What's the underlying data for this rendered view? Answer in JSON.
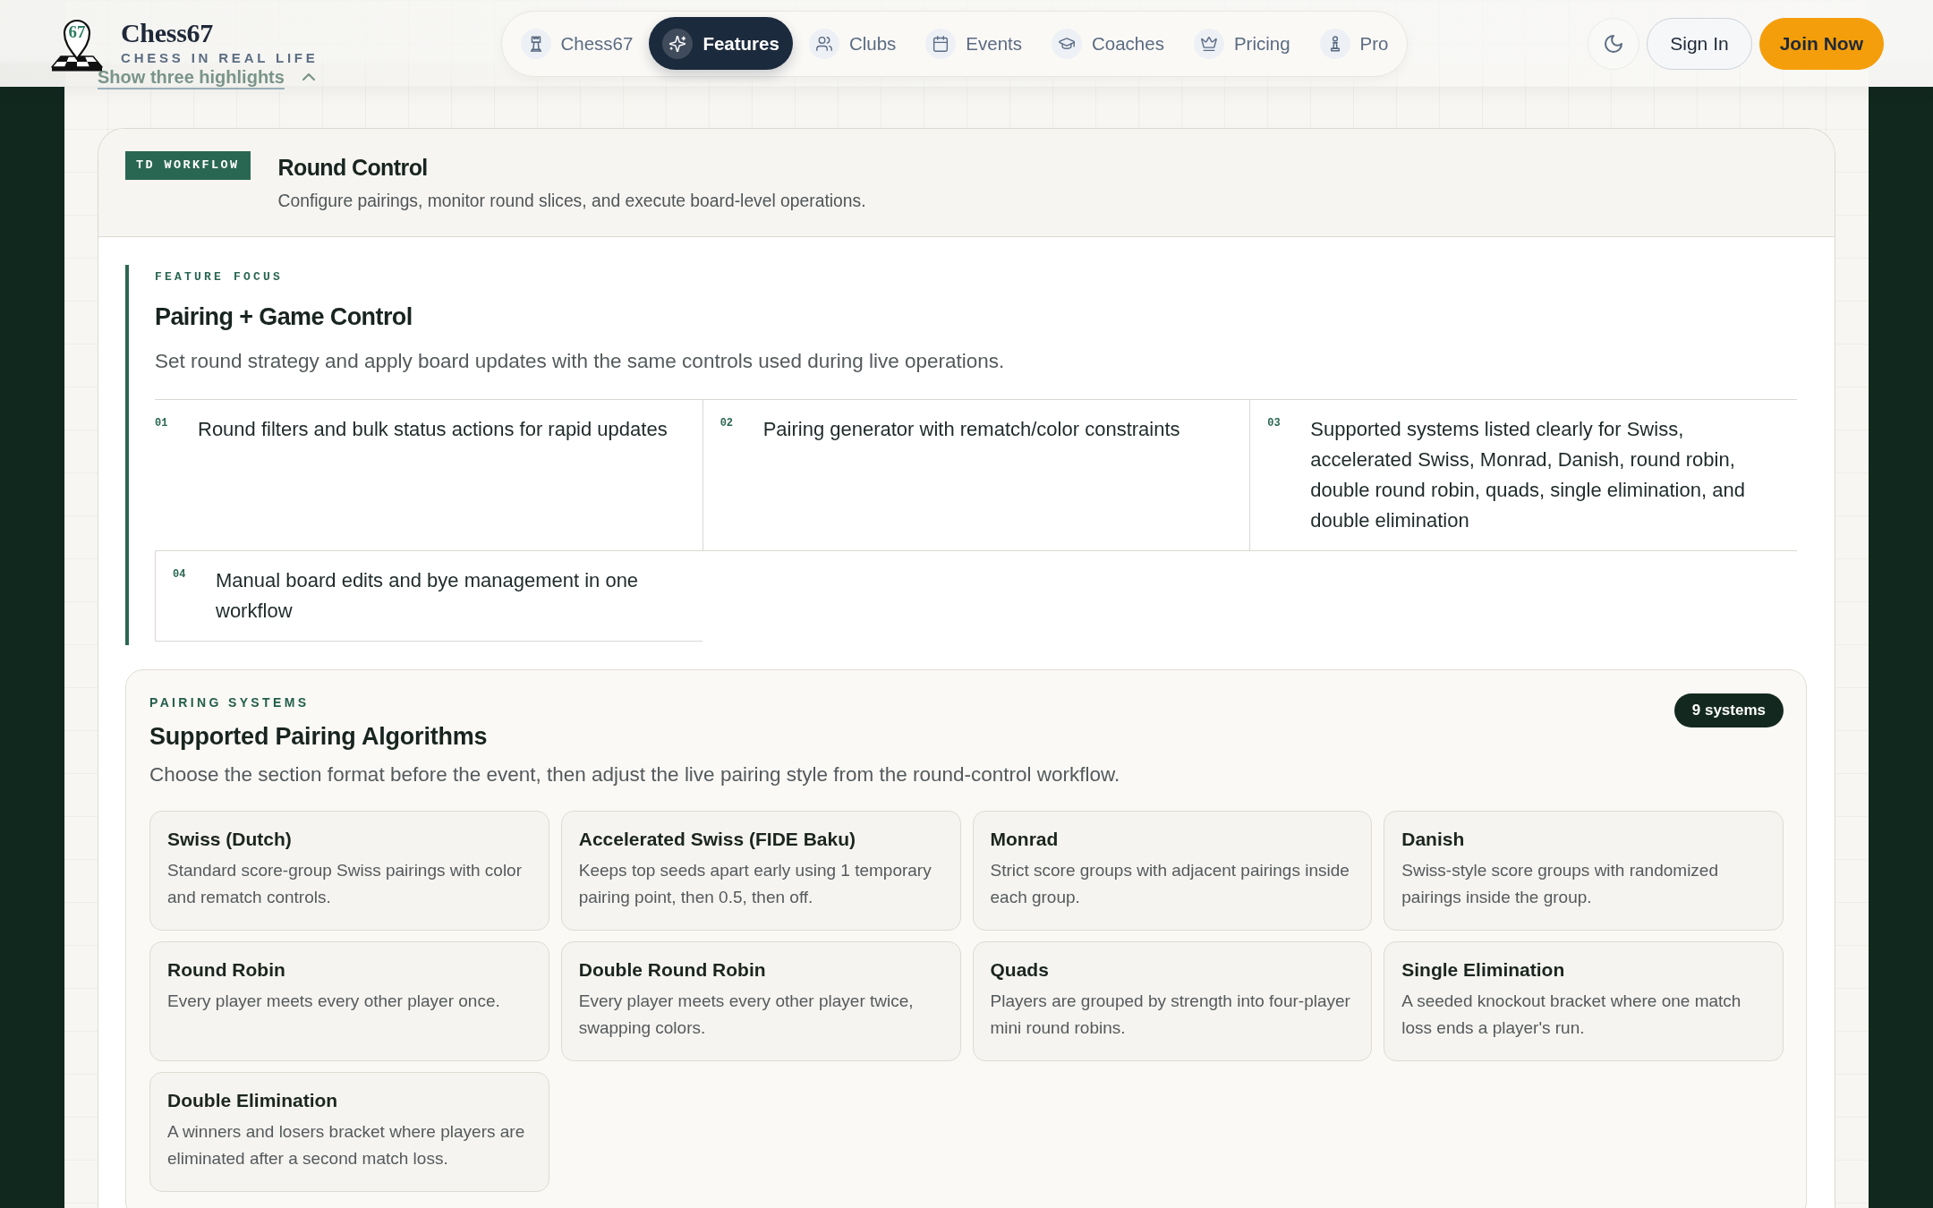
{
  "header": {
    "logo": {
      "number": "67",
      "name": "Chess67",
      "tagline": "CHESS IN REAL LIFE"
    },
    "nav": [
      {
        "label": "Chess67",
        "selected": false
      },
      {
        "label": "Features",
        "selected": true
      },
      {
        "label": "Clubs",
        "selected": false
      },
      {
        "label": "Events",
        "selected": false
      },
      {
        "label": "Coaches",
        "selected": false
      },
      {
        "label": "Pricing",
        "selected": false
      },
      {
        "label": "Pro",
        "selected": false
      }
    ],
    "actions": [
      {
        "label": "Sign In",
        "kind": "secondary"
      },
      {
        "label": "Join Now",
        "kind": "primary"
      }
    ]
  },
  "highlights_link": {
    "label": "Show three highlights"
  },
  "round_control": {
    "tag": "TD WORKFLOW",
    "title": "Round Control",
    "subtitle": "Configure pairings, monitor round slices, and execute board-level operations."
  },
  "feature_focus": {
    "eyebrow": "FEATURE FOCUS",
    "title": "Pairing + Game Control",
    "description": "Set round strategy and apply board updates with the same controls used during live operations.",
    "items": [
      {
        "number": "01",
        "text": "Round filters and bulk status actions for rapid updates"
      },
      {
        "number": "02",
        "text": "Pairing generator with rematch/color constraints"
      },
      {
        "number": "03",
        "text": "Supported systems listed clearly for Swiss, accelerated Swiss, Monrad, Danish, round robin, double round robin, quads, single elimination, and double elimination"
      },
      {
        "number": "04",
        "text": "Manual board edits and bye management in one workflow"
      }
    ]
  },
  "pairing_systems": {
    "eyebrow": "PAIRING SYSTEMS",
    "title": "Supported Pairing Algorithms",
    "count": "9 systems",
    "description": "Choose the section format before the event, then adjust the live pairing style from the round-control workflow.",
    "systems": [
      {
        "name": "Swiss (Dutch)",
        "description": "Standard score-group Swiss pairings with color and rematch controls."
      },
      {
        "name": "Accelerated Swiss (FIDE Baku)",
        "description": "Keeps top seeds apart early using 1 temporary pairing point, then 0.5, then off."
      },
      {
        "name": "Monrad",
        "description": "Strict score groups with adjacent pairings inside each group."
      },
      {
        "name": "Danish",
        "description": "Swiss-style score groups with randomized pairings inside the group."
      },
      {
        "name": "Round Robin",
        "description": "Every player meets every other player once."
      },
      {
        "name": "Double Round Robin",
        "description": "Every player meets every other player twice, swapping colors."
      },
      {
        "name": "Quads",
        "description": "Players are grouped by strength into four-player mini round robins."
      },
      {
        "name": "Single Elimination",
        "description": "A seeded knockout bracket where one match loss ends a player's run."
      },
      {
        "name": "Double Elimination",
        "description": "A winners and losers bracket where players are eliminated after a second match loss."
      }
    ]
  }
}
